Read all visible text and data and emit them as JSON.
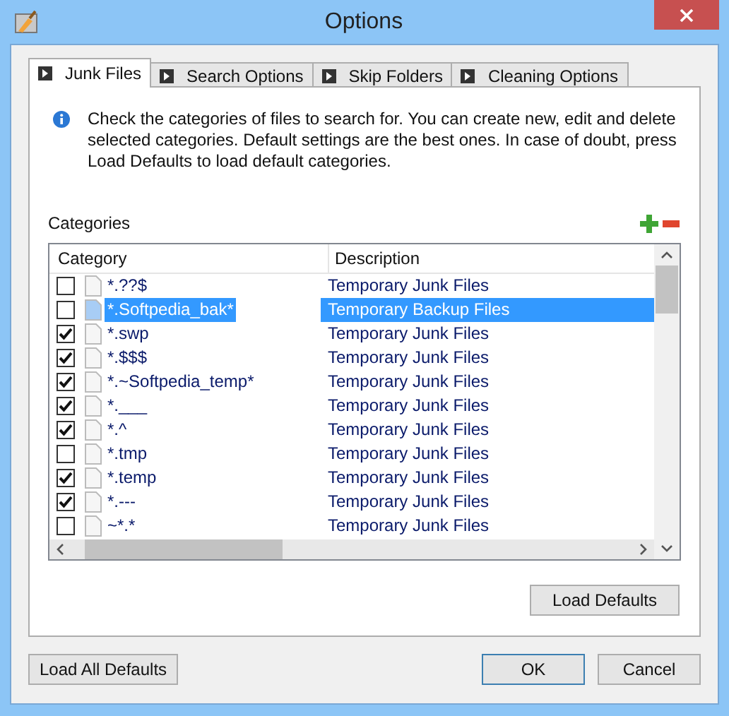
{
  "window": {
    "title": "Options"
  },
  "tabs": [
    {
      "label": "Junk Files",
      "selected": true
    },
    {
      "label": "Search Options",
      "selected": false
    },
    {
      "label": "Skip Folders",
      "selected": false
    },
    {
      "label": "Cleaning Options",
      "selected": false
    }
  ],
  "info": "Check the categories of files to search for. You can create new, edit and delete selected categories. Default settings are the best ones. In case of doubt, press Load Defaults to load default categories.",
  "categories_label": "Categories",
  "table": {
    "columns": [
      "Category",
      "Description"
    ],
    "rows": [
      {
        "category": "*.??$",
        "description": "Temporary Junk Files",
        "checked": false,
        "selected": false
      },
      {
        "category": "*.Softpedia_bak*",
        "description": "Temporary Backup Files",
        "checked": false,
        "selected": true
      },
      {
        "category": "*.swp",
        "description": "Temporary Junk Files",
        "checked": true,
        "selected": false
      },
      {
        "category": "*.$$$",
        "description": "Temporary Junk Files",
        "checked": true,
        "selected": false
      },
      {
        "category": "*.~Softpedia_temp*",
        "description": "Temporary Junk Files",
        "checked": true,
        "selected": false
      },
      {
        "category": "*.___",
        "description": "Temporary Junk Files",
        "checked": true,
        "selected": false
      },
      {
        "category": "*.^",
        "description": "Temporary Junk Files",
        "checked": true,
        "selected": false
      },
      {
        "category": "*.tmp",
        "description": "Temporary Junk Files",
        "checked": false,
        "selected": false
      },
      {
        "category": "*.temp",
        "description": "Temporary Junk Files",
        "checked": true,
        "selected": false
      },
      {
        "category": "*.---",
        "description": "Temporary Junk Files",
        "checked": true,
        "selected": false
      },
      {
        "category": "~*.*",
        "description": "Temporary Junk Files",
        "checked": false,
        "selected": false
      }
    ]
  },
  "load_defaults": "Load Defaults",
  "buttons": {
    "load_all": "Load All Defaults",
    "ok": "OK",
    "cancel": "Cancel"
  }
}
